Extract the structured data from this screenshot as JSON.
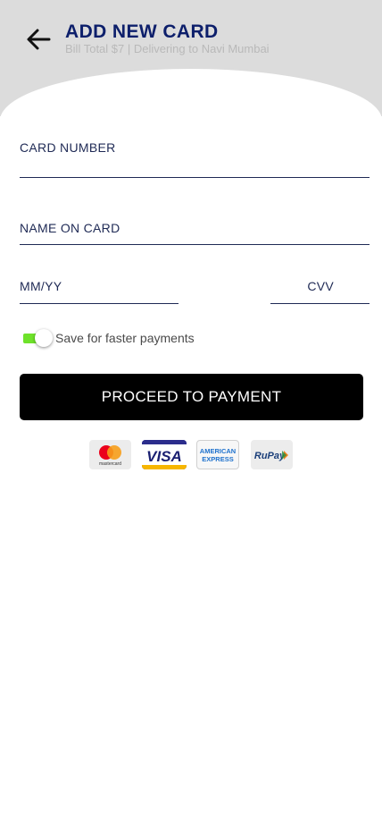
{
  "header": {
    "back_icon": "arrow-left-icon",
    "title": "ADD NEW CARD",
    "subtitle": "Bill Total $7 | Delivering to Navi Mumbai",
    "background_color": "#dcdcdc",
    "title_color": "#0d1f6b"
  },
  "form": {
    "card_number_label": "CARD NUMBER",
    "name_on_card_label": "NAME ON CARD",
    "expiry_label": "MM/YY",
    "cvv_label": "CVV",
    "save_toggle": {
      "label": "Save for faster payments",
      "on": true,
      "color": "#6ee22a"
    },
    "proceed_label": "PROCEED TO PAYMENT"
  },
  "card_logos": [
    {
      "name": "mastercard-logo",
      "text": "mastercard"
    },
    {
      "name": "visa-logo",
      "text": "VISA"
    },
    {
      "name": "american-express-logo",
      "line1": "AMERICAN",
      "line2": "EXPRESS"
    },
    {
      "name": "rupay-logo",
      "text": "RuPay"
    }
  ]
}
